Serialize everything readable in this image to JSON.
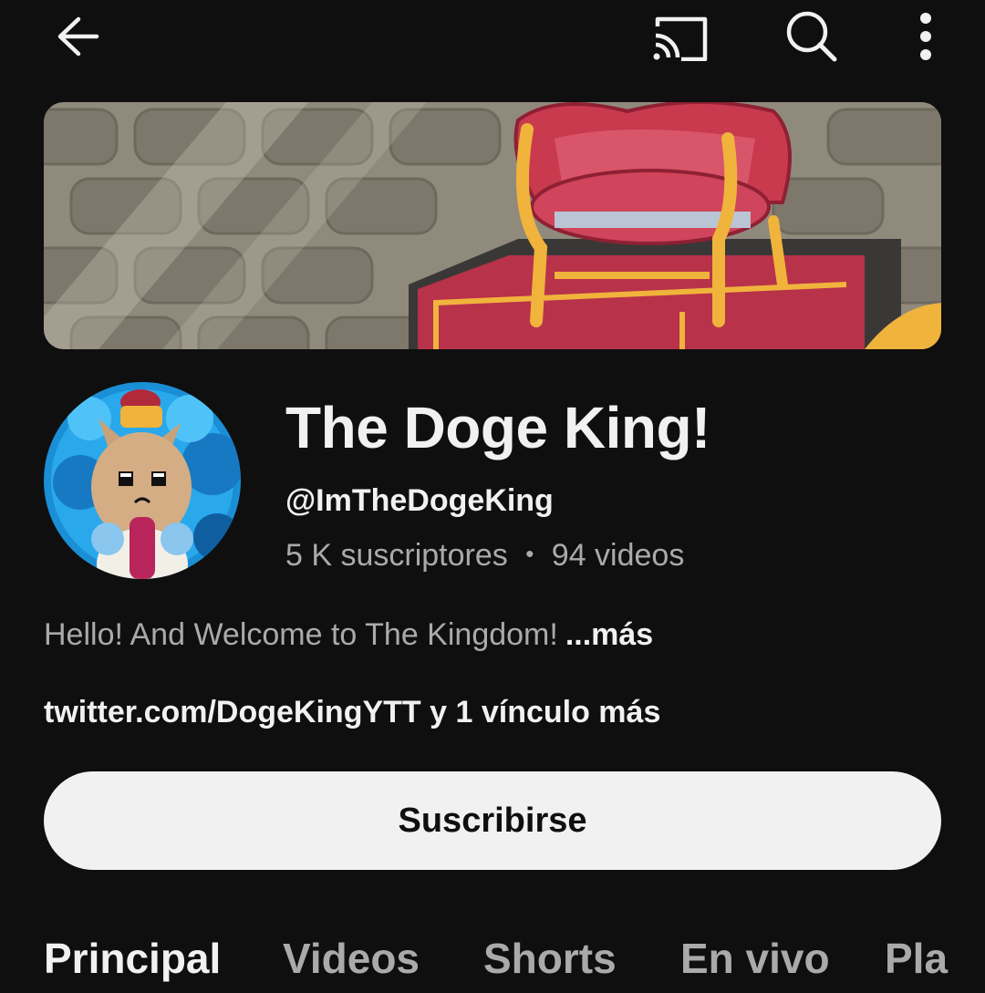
{
  "toolbar": {
    "back_icon": "arrow-left-icon",
    "cast_icon": "cast-icon",
    "search_icon": "search-icon",
    "more_icon": "more-vertical-icon"
  },
  "channel": {
    "title": "The Doge King!",
    "handle": "@ImTheDogeKing",
    "subscribers": "5 K suscriptores",
    "separator": "•",
    "videos": "94 videos",
    "description": "Hello! And Welcome to The Kingdom!",
    "description_more": "...más",
    "links": "twitter.com/DogeKingYTT y 1 vínculo más"
  },
  "actions": {
    "subscribe_label": "Suscribirse"
  },
  "tabs": [
    {
      "label": "Principal",
      "active": true
    },
    {
      "label": "Videos",
      "active": false
    },
    {
      "label": "Shorts",
      "active": false
    },
    {
      "label": "En vivo",
      "active": false
    },
    {
      "label": "Pla",
      "active": false
    }
  ],
  "colors": {
    "background": "#0f0f0f",
    "text_primary": "#f1f1f1",
    "text_secondary": "#aaaaaa",
    "button_bg": "#f1f1f1"
  }
}
